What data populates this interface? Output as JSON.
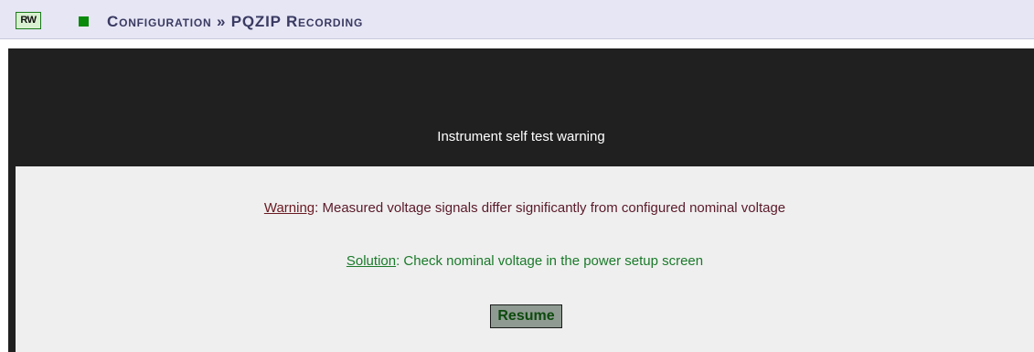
{
  "header": {
    "rw_badge": "RW",
    "title": "Configuration » PQZIP Recording"
  },
  "dialog": {
    "title": "Instrument self test warning",
    "warning_label": "Warning",
    "warning_text": ": Measured voltage signals differ significantly from configured nominal voltage",
    "solution_label": "Solution",
    "solution_text": ": Check nominal voltage in the power setup screen",
    "resume_label": "Resume"
  },
  "colors": {
    "header_bg": "#e6e6f5",
    "panel_bg": "#202020",
    "box_bg": "#efefef",
    "warning": "#5a1a2a",
    "solution": "#1a7a2a",
    "status_green": "#0a8a0a"
  }
}
